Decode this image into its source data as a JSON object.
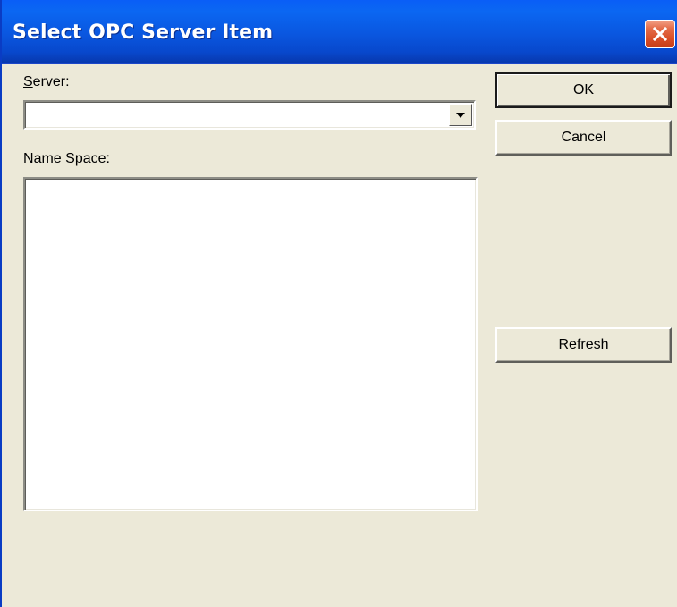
{
  "window": {
    "title": "Select OPC Server Item"
  },
  "server": {
    "label_first": "S",
    "label_rest": "erver:",
    "value": ""
  },
  "namespace": {
    "label_first": "N",
    "label_u": "a",
    "label_rest": "me Space:",
    "items": []
  },
  "buttons": {
    "ok_label": "OK",
    "cancel_label": "Cancel",
    "refresh_first": "R",
    "refresh_rest": "efresh"
  },
  "icons": {
    "close": "close-icon",
    "dropdown": "chevron-down-icon"
  },
  "colors": {
    "titlebar": "#0a56df",
    "dialog_bg": "#ece9d8",
    "close_button": "#d84d25"
  }
}
